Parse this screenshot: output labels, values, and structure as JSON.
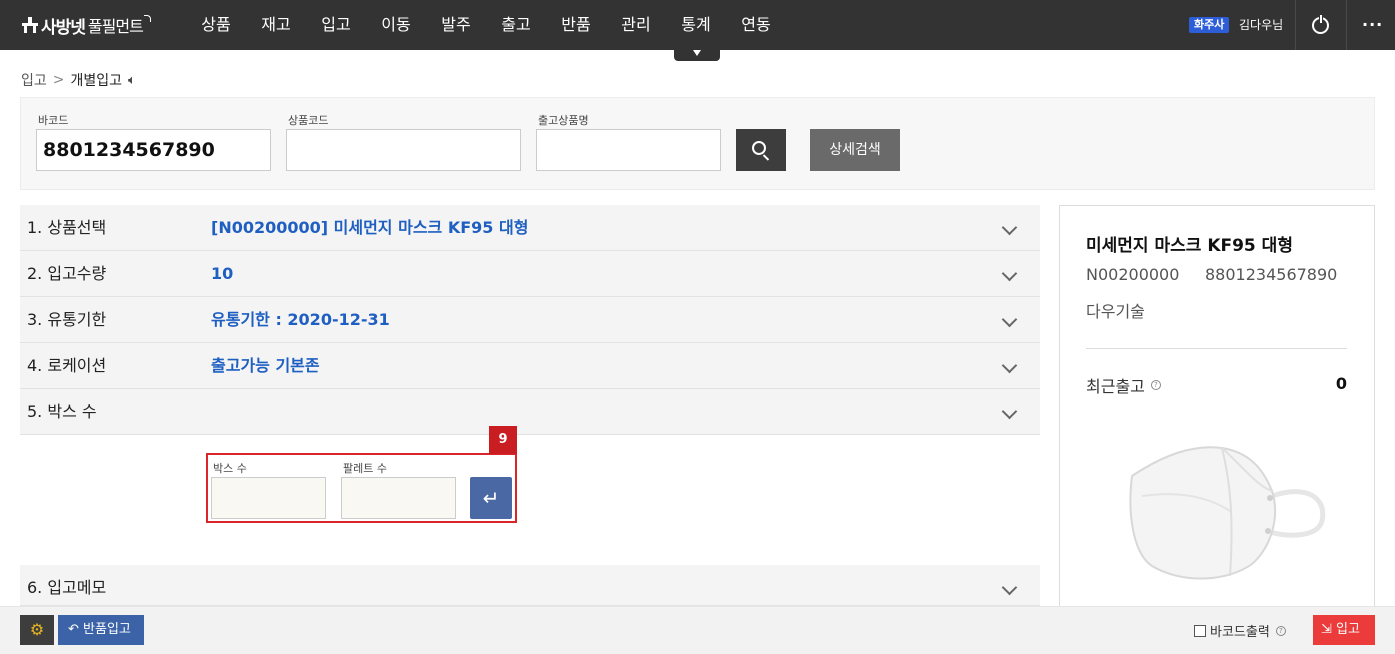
{
  "brand": {
    "name_bold": "사방넷",
    "name_light": "풀필먼트"
  },
  "nav": {
    "items": [
      "상품",
      "재고",
      "입고",
      "이동",
      "발주",
      "출고",
      "반품",
      "관리",
      "통계",
      "연동"
    ]
  },
  "user": {
    "role_badge": "화주사",
    "name": "김다우님"
  },
  "breadcrumb": {
    "parent": "입고",
    "current": "개별입고"
  },
  "search": {
    "barcode_label": "바코드",
    "barcode_value": "8801234567890",
    "product_code_label": "상품코드",
    "product_code_value": "",
    "product_name_label": "출고상품명",
    "product_name_value": "",
    "advanced_label": "상세검색"
  },
  "steps": [
    {
      "label": "1. 상품선택",
      "value": "[N00200000] 미세먼지 마스크 KF95 대형"
    },
    {
      "label": "2. 입고수량",
      "value": "10"
    },
    {
      "label": "3. 유통기한",
      "value": "유통기한 : 2020-12-31"
    },
    {
      "label": "4. 로케이션",
      "value": "출고가능 기본존"
    },
    {
      "label": "5. 박스 수",
      "value": ""
    },
    {
      "label": "6. 입고메모",
      "value": ""
    }
  ],
  "box_form": {
    "marker": "9",
    "box_count_label": "박스 수",
    "pallet_count_label": "팔레트 수",
    "box_count_value": "",
    "pallet_count_value": ""
  },
  "product_panel": {
    "name": "미세먼지 마스크 KF95 대형",
    "code": "N00200000",
    "barcode": "8801234567890",
    "maker": "다우기술",
    "recent_out_label": "최근출고",
    "recent_out_value": "0",
    "image_icon": "mask-image"
  },
  "footer": {
    "return_label": "반품입고",
    "barcode_print_label": "바코드출력",
    "barcode_print_checked": false,
    "receive_label": "입고"
  },
  "colors": {
    "nav_bg": "#333333",
    "link_blue": "#1f5fc2",
    "accent_red": "#ec3b3b",
    "role_badge": "#2d5ed8"
  }
}
